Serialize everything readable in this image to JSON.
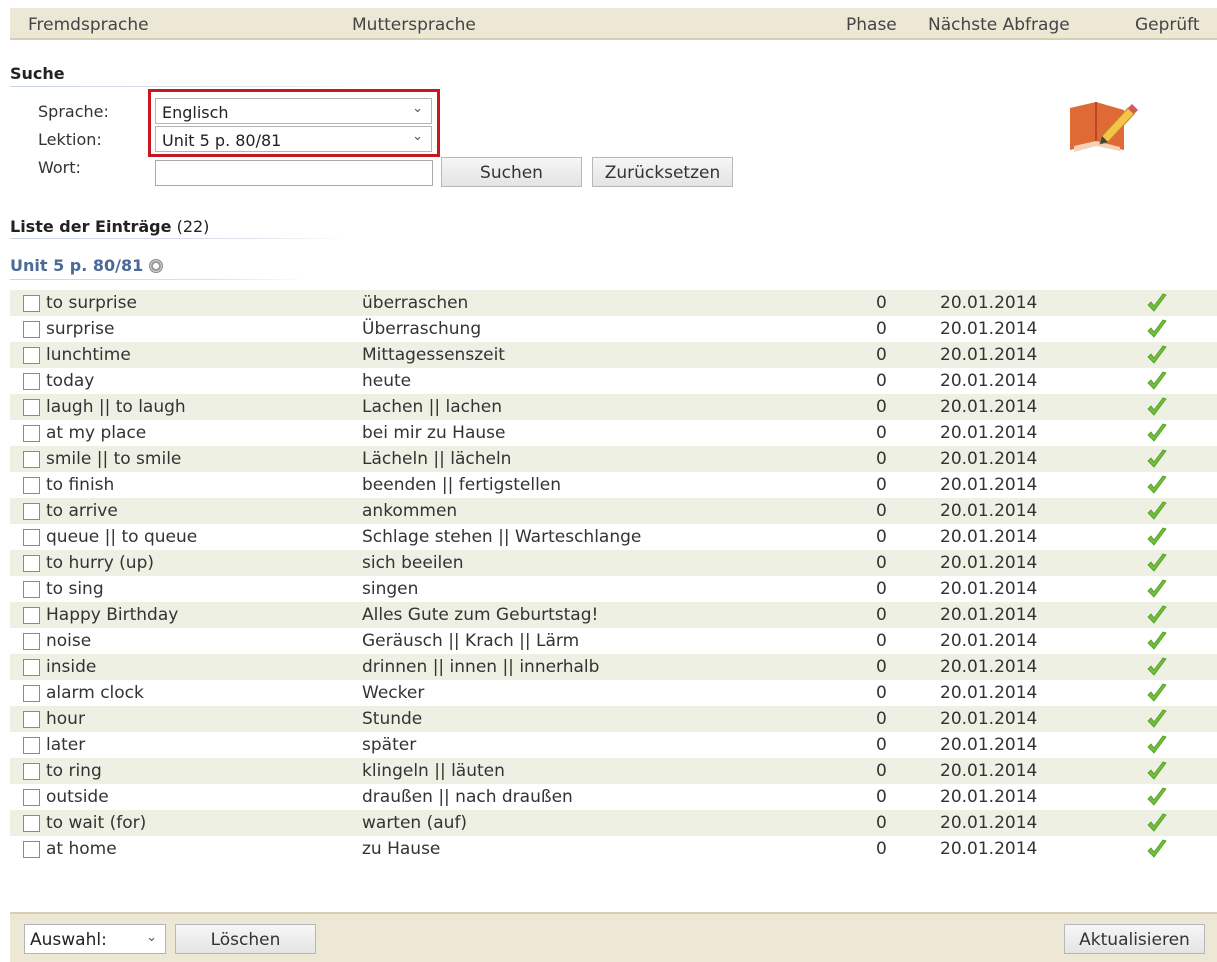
{
  "header": {
    "col_foreign": "Fremdsprache",
    "col_native": "Muttersprache",
    "col_phase": "Phase",
    "col_next": "Nächste Abfrage",
    "col_checked": "Geprüft"
  },
  "search": {
    "title": "Suche",
    "language_label": "Sprache:",
    "language_value": "Englisch",
    "lesson_label": "Lektion:",
    "lesson_value": "Unit 5 p. 80/81",
    "word_label": "Wort:",
    "word_value": "",
    "search_button": "Suchen",
    "reset_button": "Zurücksetzen"
  },
  "list": {
    "title": "Liste der Einträge",
    "count": "(22)",
    "unit_title": "Unit 5 p. 80/81"
  },
  "icons": {
    "book": "book-edit-icon",
    "gear": "gear-icon",
    "check": "checkmark-icon"
  },
  "colors": {
    "highlight": "#c8171e",
    "header_bg": "#ede8d6",
    "row_alt": "#eef0e4",
    "unit_title": "#4b6a96",
    "check": "#6fbf3a"
  },
  "entries": [
    {
      "foreign": "to surprise",
      "native": "überraschen",
      "phase": "0",
      "next": "20.01.2014"
    },
    {
      "foreign": "surprise",
      "native": "Überraschung",
      "phase": "0",
      "next": "20.01.2014"
    },
    {
      "foreign": "lunchtime",
      "native": "Mittagessenszeit",
      "phase": "0",
      "next": "20.01.2014"
    },
    {
      "foreign": "today",
      "native": "heute",
      "phase": "0",
      "next": "20.01.2014"
    },
    {
      "foreign": "laugh || to laugh",
      "native": "Lachen || lachen",
      "phase": "0",
      "next": "20.01.2014"
    },
    {
      "foreign": "at my place",
      "native": "bei mir zu Hause",
      "phase": "0",
      "next": "20.01.2014"
    },
    {
      "foreign": "smile || to smile",
      "native": "Lächeln || lächeln",
      "phase": "0",
      "next": "20.01.2014"
    },
    {
      "foreign": "to finish",
      "native": "beenden || fertigstellen",
      "phase": "0",
      "next": "20.01.2014"
    },
    {
      "foreign": "to arrive",
      "native": "ankommen",
      "phase": "0",
      "next": "20.01.2014"
    },
    {
      "foreign": "queue || to queue",
      "native": "Schlage stehen || Warteschlange",
      "phase": "0",
      "next": "20.01.2014"
    },
    {
      "foreign": "to hurry (up)",
      "native": "sich beeilen",
      "phase": "0",
      "next": "20.01.2014"
    },
    {
      "foreign": "to sing",
      "native": "singen",
      "phase": "0",
      "next": "20.01.2014"
    },
    {
      "foreign": "Happy Birthday",
      "native": "Alles Gute zum Geburtstag!",
      "phase": "0",
      "next": "20.01.2014"
    },
    {
      "foreign": "noise",
      "native": "Geräusch || Krach || Lärm",
      "phase": "0",
      "next": "20.01.2014"
    },
    {
      "foreign": "inside",
      "native": "drinnen || innen || innerhalb",
      "phase": "0",
      "next": "20.01.2014"
    },
    {
      "foreign": "alarm clock",
      "native": "Wecker",
      "phase": "0",
      "next": "20.01.2014"
    },
    {
      "foreign": "hour",
      "native": "Stunde",
      "phase": "0",
      "next": "20.01.2014"
    },
    {
      "foreign": "later",
      "native": "später",
      "phase": "0",
      "next": "20.01.2014"
    },
    {
      "foreign": "to ring",
      "native": "klingeln || läuten",
      "phase": "0",
      "next": "20.01.2014"
    },
    {
      "foreign": "outside",
      "native": "draußen || nach draußen",
      "phase": "0",
      "next": "20.01.2014"
    },
    {
      "foreign": "to wait (for)",
      "native": "warten (auf)",
      "phase": "0",
      "next": "20.01.2014"
    },
    {
      "foreign": "at home",
      "native": "zu Hause",
      "phase": "0",
      "next": "20.01.2014"
    }
  ],
  "footer": {
    "selection_value": "Auswahl:",
    "delete_button": "Löschen",
    "refresh_button": "Aktualisieren"
  }
}
